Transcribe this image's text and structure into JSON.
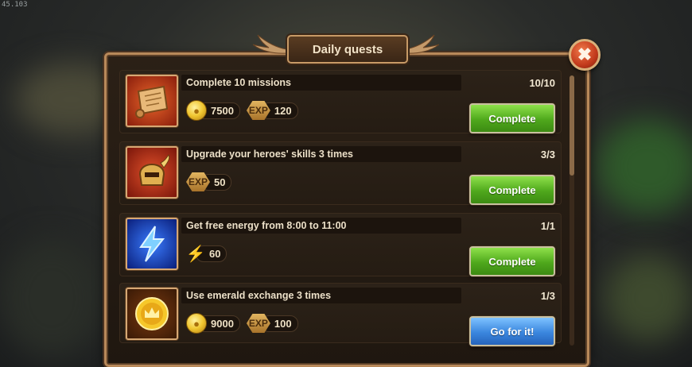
{
  "debug": {
    "fps_text": "45.103"
  },
  "dialog": {
    "title": "Daily quests",
    "close_label": "✖"
  },
  "quests": [
    {
      "name": "Complete 10 missions",
      "progress": "10/10",
      "icon": "scroll-icon",
      "rewards": [
        {
          "type": "gold-coin-icon",
          "amount": "7500"
        },
        {
          "type": "exp-icon",
          "label": "EXP",
          "amount": "120"
        }
      ],
      "button": {
        "label": "Complete",
        "style": "green"
      }
    },
    {
      "name": "Upgrade your heroes' skills 3 times",
      "progress": "3/3",
      "icon": "helmet-icon",
      "rewards": [
        {
          "type": "exp-icon",
          "label": "EXP",
          "amount": "50"
        }
      ],
      "button": {
        "label": "Complete",
        "style": "green"
      }
    },
    {
      "name": "Get free energy from 8:00 to 11:00",
      "progress": "1/1",
      "icon": "energy-bolt-icon",
      "rewards": [
        {
          "type": "energy-icon",
          "amount": "60"
        }
      ],
      "button": {
        "label": "Complete",
        "style": "green"
      }
    },
    {
      "name": "Use emerald exchange 3 times",
      "progress": "1/3",
      "icon": "crown-coin-icon",
      "rewards": [
        {
          "type": "gold-coin-icon",
          "amount": "9000"
        },
        {
          "type": "exp-icon",
          "label": "EXP",
          "amount": "100"
        }
      ],
      "button": {
        "label": "Go for it!",
        "style": "blue"
      }
    }
  ],
  "colors": {
    "complete_button": "#5cb82a",
    "goforit_button": "#3a86de",
    "frame": "#b8895a"
  }
}
